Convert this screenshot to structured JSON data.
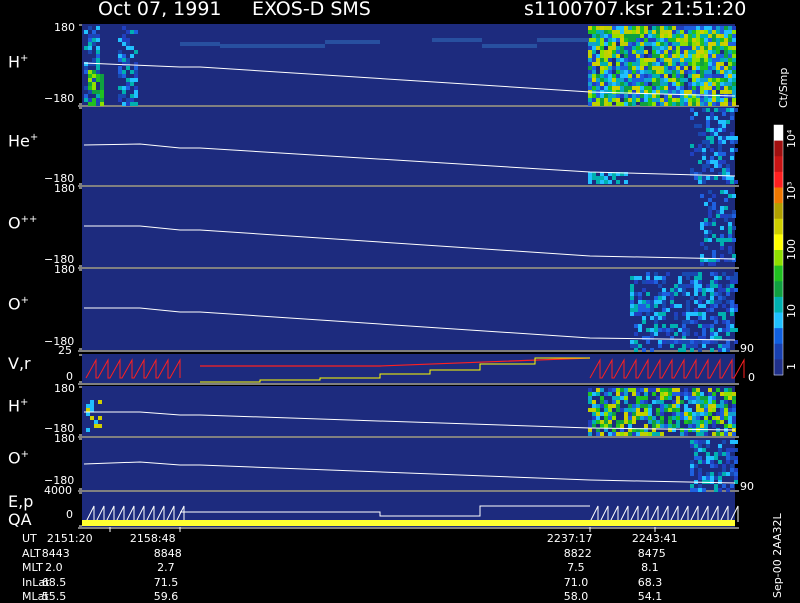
{
  "header": {
    "date": "Oct 07, 1991",
    "mission": "EXOS-D SMS",
    "file": "s1100707.ksr",
    "time": "21:51:20"
  },
  "panels": [
    {
      "label": "H",
      "sup": "+",
      "top": "180",
      "bottom": "−180"
    },
    {
      "label": "He",
      "sup": "+",
      "top": "",
      "bottom": "−180"
    },
    {
      "label": "O",
      "sup": "++",
      "top": "180",
      "bottom": "−180"
    },
    {
      "label": "O",
      "sup": "+",
      "top": "180",
      "bottom": "−180"
    },
    {
      "label": "V,r",
      "sup": "",
      "top": "25",
      "bottom": "0"
    },
    {
      "label": "H",
      "sup": "+",
      "top": "180",
      "bottom": "−180"
    },
    {
      "label": "O",
      "sup": "+",
      "top": "180",
      "bottom": "−180"
    },
    {
      "label": "E,p",
      "sup": "",
      "top": "4000",
      "bottom": "0"
    },
    {
      "label": "QA",
      "sup": "",
      "top": "",
      "bottom": ""
    }
  ],
  "panel_ticks": {
    "he_top": "180",
    "v_top": "180",
    "h2_top": "180"
  },
  "right_ticks": {
    "o_plus_90": "90",
    "o_plus2_90": "90",
    "v_zero": "0"
  },
  "colorbar": {
    "unit": "Ct/Smp",
    "labels": [
      "10⁴",
      "10³",
      "100",
      "10",
      "1"
    ],
    "colors": [
      "#ffffff",
      "#a01010",
      "#c81414",
      "#ff2020",
      "#f07800",
      "#b0a000",
      "#d0d000",
      "#ffff00",
      "#90e000",
      "#20c020",
      "#10a040",
      "#00b0b0",
      "#20c0ff",
      "#1060e0",
      "#1840b0",
      "#20308a"
    ]
  },
  "footer": {
    "rows": [
      {
        "name": "UT",
        "values": [
          "2151:20",
          "2158:48",
          "2237:17",
          "2243:41"
        ]
      },
      {
        "name": "ALT",
        "values": [
          "8443",
          "8848",
          "8822",
          "8475"
        ]
      },
      {
        "name": "MLT",
        "values": [
          "2.0",
          "2.7",
          "7.5",
          "8.1"
        ]
      },
      {
        "name": "InLat",
        "values": [
          "68.5",
          "71.5",
          "71.0",
          "68.3"
        ]
      },
      {
        "name": "MLat",
        "values": [
          "55.5",
          "59.6",
          "58.0",
          "54.1"
        ]
      }
    ],
    "stamp": "Sep-00 2AA32L"
  },
  "chart_data": {
    "type": "heatmap",
    "title": "Oct 07, 1991   EXOS-D SMS",
    "x_ticks": [
      "2151:20",
      "2158:48",
      "2237:17",
      "2243:41"
    ],
    "colorbar_unit": "Ct/Smp",
    "colorbar_range": [
      1,
      10000
    ],
    "colorbar_scale": "log",
    "ylim_pitch": [
      -180,
      180
    ],
    "ylim_velocity": [
      0,
      25
    ],
    "ylim_energy": [
      0,
      4000
    ],
    "panel_count": 9
  }
}
